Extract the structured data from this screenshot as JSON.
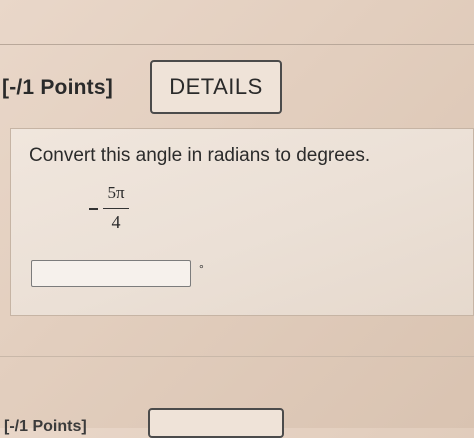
{
  "header": {
    "points_label": "[-/1 Points]",
    "details_label": "DETAILS"
  },
  "question": {
    "prompt": "Convert this angle in radians to degrees.",
    "angle": {
      "sign": "−",
      "numerator": "5π",
      "denominator": "4"
    },
    "answer": {
      "value": "",
      "placeholder": ""
    },
    "unit_symbol": "°"
  },
  "next_question": {
    "points_label": "[-/1 Points]"
  }
}
